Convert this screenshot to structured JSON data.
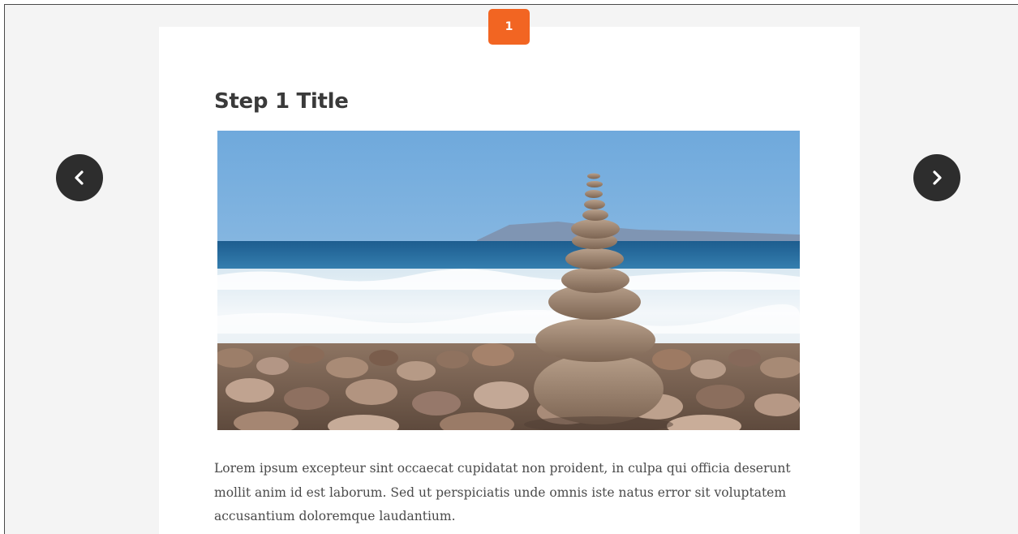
{
  "step": {
    "number": "1",
    "title": "Step 1 Title",
    "image_alt": "Stack of balanced stones on a pebble beach with ocean waves",
    "body": "Lorem ipsum excepteur sint occaecat cupidatat non proident, in culpa qui officia deserunt mollit anim id est laborum. Sed ut perspiciatis unde omnis iste natus error sit voluptatem accusantium doloremque laudantium."
  },
  "navigation": {
    "prev_icon": "chevron-left-icon",
    "next_icon": "chevron-right-icon"
  },
  "colors": {
    "accent": "#f26522",
    "nav_button": "#2d2d2d",
    "page_background": "#f4f4f4",
    "card_background": "#ffffff"
  }
}
